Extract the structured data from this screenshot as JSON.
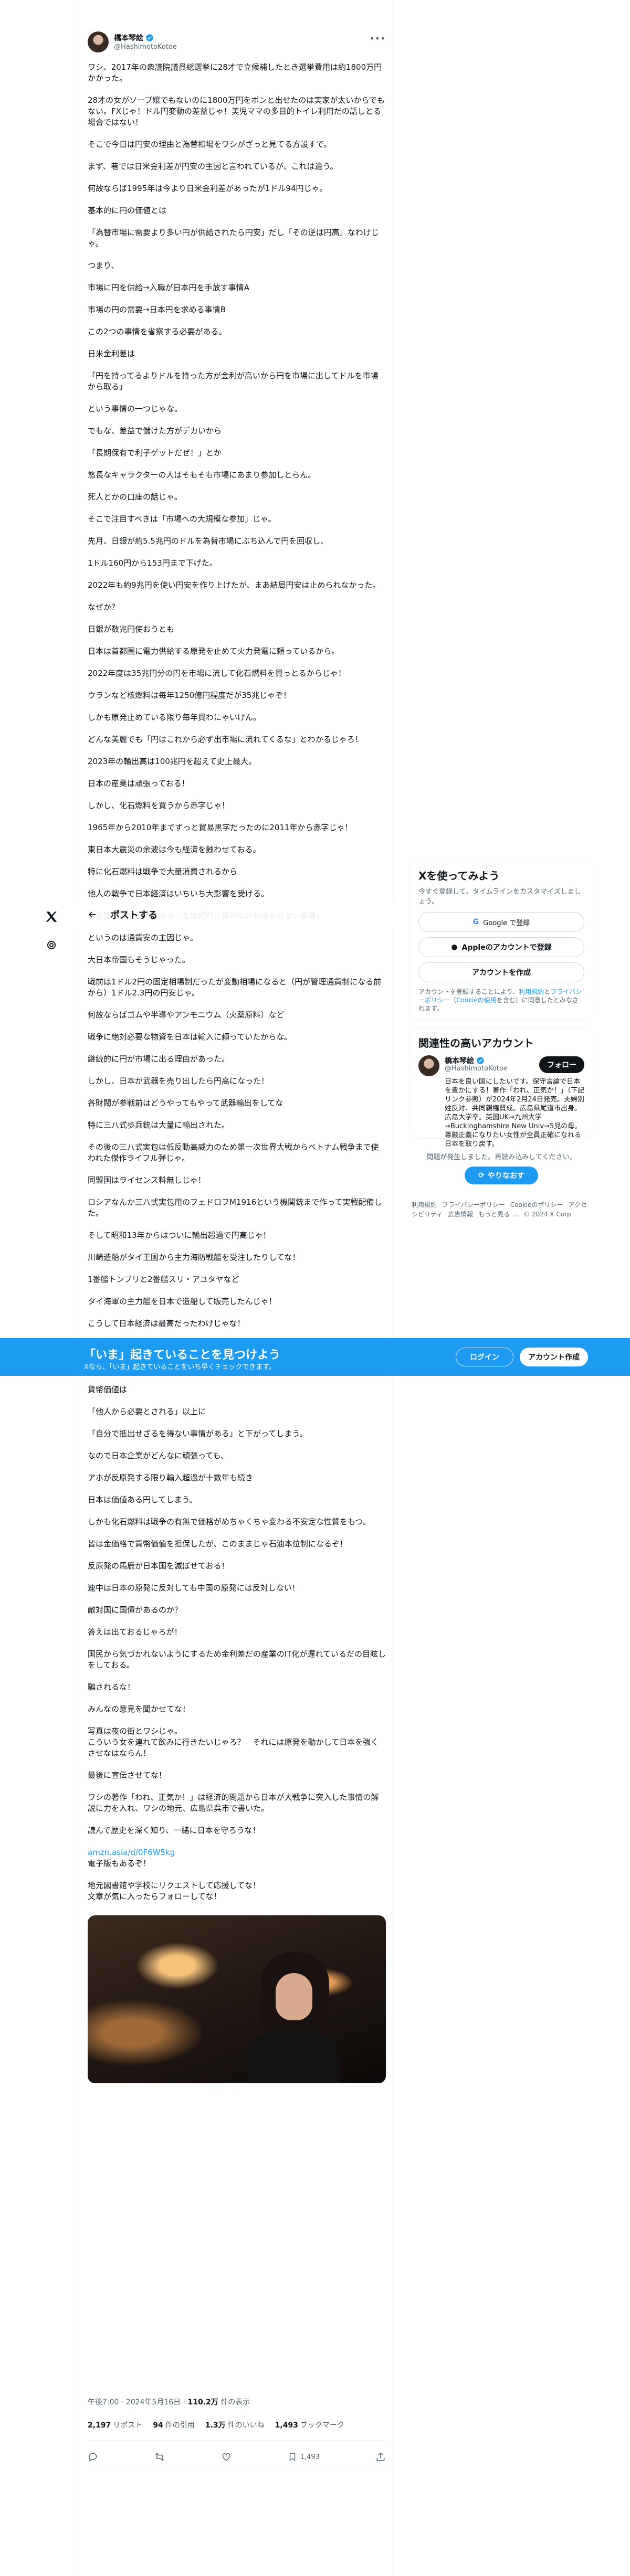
{
  "author": {
    "name": "橋本琴絵",
    "handle": "@HashimotoKotoe"
  },
  "tweet": {
    "paragraphs": [
      "ワシ、2017年の衆議院議員総選挙に28才で立候補したとき選挙費用は約1800万円かかった。",
      "28才の女がソープ嬢でもないのに1800万円をポンと出せたのは実家が太いからでもない。FXじゃ！ドル円変動の差益じゃ！美児ママの多目的トイレ利用だの話しとる場合ではない！",
      "そこで今日は円安の理由と為替相場をワシがざっと見てる方設すで。",
      "まず、巷では日米金利差が円安の主因と言われているが、これは違う。",
      "何故ならば1995年は今より日米金利差があったが1ドル94円じゃ。",
      "基本的に円の価値とは",
      "「為替市場に需要より多い円が供給されたら円安」だし「その逆は円高」なわけじゃ。",
      "つまり、",
      "市場に円を供給→入職が日本円を手放す事情A",
      "市場の円の需要→日本円を求める事情B",
      "この2つの事情を省察する必要がある。",
      "日米金利差は",
      "「円を持ってるよりドルを持った方が金利が高いから円を市場に出してドルを市場から取る」",
      "という事情の一つじゃな。",
      "でもな、差益で儲けた方がデカいから",
      "「長期保有で利子ゲットだぜ！」とか",
      "悠長なキャラクターの人はそもそも市場にあまり参加しとらん。",
      "死人とかの口座の話じゃ。",
      "そこで注目すべきは「市場への大規模な参加」じゃ。",
      "先月、日銀が約5.5兆円のドルを為替市場にぶち込んで円を回収し、",
      "1ドル160円から153円まで下げた。",
      "2022年も約9兆円を使い円安を作り上げたが、まあ結局円安は止められなかった。",
      "なぜか？",
      "日銀が数兆円使おうとも",
      "日本は首都圏に電力供給する原発を止めて火力発電に頼っているから。",
      "2022年度は35兆円分の円を市場に流して化石燃料を買っとるからじゃ！",
      "ウランなど核燃料は毎年1250億円程度だが35兆じゃぞ！",
      "しかも原発止めている限り毎年買わにゃいけん。",
      "どんな美麗でも「円はこれから必ず出市場に流れてくるな」とわかるじゃろ！",
      "2023年の輸出高は100兆円を超えて史上最大。",
      "日本の産業は頑張っておる！",
      "しかし、化石燃料を買うから赤字じゃ！",
      "1965年から2010年までずっと貿易黒字だったのに2011年から赤字じゃ！",
      "東日本大震災の余波は今も経済を蝕わせておる。",
      "特に化石燃料は戦争で大量消費されるから",
      "他人の戦争で日本経済はいちいち大影響を受ける。",
      "「自国に無いが必要なモノを継続的に買わなければならない事情」",
      "というのは通貨安の主因じゃ。",
      "大日本帝国もそうじゃった。",
      "戦前は1ドル2円の固定相場制だったが変動相場になると（円が管理通貨制になる前から）1ドル2.3円の円安じゃ。",
      "何故ならばゴムや半導やアンモニウム（火薬原料）など",
      "戦争に絶対必要な物資を日本は輸入に頼っていたからな。",
      "継続的に円が市場に出る理由があった。",
      "しかし、日本が武器を売り出したら円高になった！",
      "各財閥が参戦前はどうやってもやって武器輸出をしてな",
      "特に三八式歩兵銃は大量に輸出された。",
      "その後の三八式実包は低反動高威力のため第一次世界大戦からベトナム戦争まで使われた傑作ライフル弾じゃ。",
      "同盟国はライセンス料無しじゃ！",
      "ロシアなんか三八式実包用のフェドロフM1916という機関銃まで作って実戦配備した。",
      "そして昭和13年からはついに輸出超過で円高じゃ！",
      "川崎造船がタイ王国から主力海防戦艦を受注したりしてな！",
      "1番艦トンブリと2番艦スリ・アユタヤなど",
      "タイ海軍の主力艦を日本で造船して販売したんじゃ！",
      "こうして日本経済は最高だったわけじゃな！",
      "当時の火力発電は重油じゃなくて石炭だから国内で採掘できたしな！",
      "話をまとめるぞ。",
      "貨幣価値は",
      "「他人から必要とされる」以上に",
      "「自分で抵出せざるを得ない事情がある」と下がってしまう。",
      "なので日本企業がどんなに頑張っても、",
      "アホが反原発する限り輸入超過が十数年も続き",
      "日本は価値ある円してしまう。",
      "しかも化石燃料は戦争の有無で価格がめちゃくちゃ変わる不安定な性質をもつ。",
      "皆は金価格で貨幣価値を担保したが、このままじゃ石油本位制になるぞ！",
      "反原発の馬鹿が日本国を滅ぼせておる！",
      "連中は日本の原発に反対しても中国の原発には反対しない！",
      "敵対国に国債があるのか？",
      "答えは出ておるじゃろが！",
      "国民から気づかれないようにするため金利差だの産業のIT化が遅れているだの目眩しをしておる。",
      "騙されるな！",
      "みんなの意見を聞かせてな！",
      "写真は夜の街とワシじゃ。\nこういう女を連れて飲みに行きたいじゃろ？　それには原発を動かして日本を強くさせなはならん！",
      "最後に宣伝させてな！",
      "ワシの著作「われ、正気か！」は経済的問題から日本が大戦争に突入した事情の解説に力を入れ、ワシの地元、広島県呉市で書いた。",
      "読んで歴史を深く知り、一緒に日本を守ろうな！"
    ],
    "link": "amzn.asia/d/0F6W5kg",
    "link_tail": "電子版もあるぞ！",
    "closing": "地元図書館や学校にリクエストして応援してな！\n文章が気に入ったらフォローしてな！",
    "time": "午後7:00 · 2024年5月16日 · ",
    "views_count": "110.2万",
    "views_label": " 件の表示",
    "stats": {
      "reposts_count": "2,197",
      "reposts_label": "リポスト",
      "quotes_count": "94",
      "quotes_label": "件の引用",
      "likes_count": "1.3万",
      "likes_label": "件のいいね",
      "bookmarks_count": "1,493",
      "bookmarks_label": "ブックマーク"
    },
    "bookmark_action_count": "1,493"
  },
  "sticky_header": {
    "title": "ポストする"
  },
  "sidebar": {
    "signup": {
      "title": "Xを使ってみよう",
      "subtitle": "今すぐ登録して、タイムラインをカスタマイズしましょう。",
      "google_label": "Google で登録",
      "apple_label": "Appleのアカウントで登録",
      "create_label": "アカウントを作成",
      "terms_prefix": "アカウントを登録することにより、",
      "terms_link1": "利用規約",
      "terms_mid": "と",
      "terms_link2": "プライバシーポリシー",
      "terms_mid2": "（",
      "terms_link3": "Cookieの使用",
      "terms_suffix": "を含む）に同意したとみなされます。"
    },
    "related": {
      "title": "関連性の高いアカウント",
      "name": "橋本琴絵",
      "handle": "@HashimotoKotoe",
      "follow_label": "フォロー",
      "bio": "日本を良い国にしたいです。保守言論で日本を豊かにする！著作「われ、正気か！」（下記リンク参照）が2024年2月24日発売。夫婦別姓反対、共同親権賛成。広島県尾道市出身。広島大学卒。英国UK→九州大学→Buckinghamshire New Univ→5児の母。尊厳正義になりたい女性が全員正確になれる日本を取り戻す。"
    },
    "error": {
      "text": "問題が発生しました。再読み込みしてください。",
      "retry_label": "やりなおす"
    },
    "footer": [
      "利用規約",
      "プライバシーポリシー",
      "Cookieのポリシー",
      "アクセシビリティ",
      "広告情報",
      "もっと見る …",
      "© 2024 X Corp."
    ]
  },
  "banner": {
    "title": "「いま」起きていることを見つけよう",
    "subtitle": "Xなら、「いま」起きていることをいち早くチェックできます。",
    "login_label": "ログイン",
    "signup_label": "アカウント作成"
  },
  "colors": {
    "accent": "#1d9bf0",
    "text": "#0f1419",
    "muted": "#536471"
  }
}
